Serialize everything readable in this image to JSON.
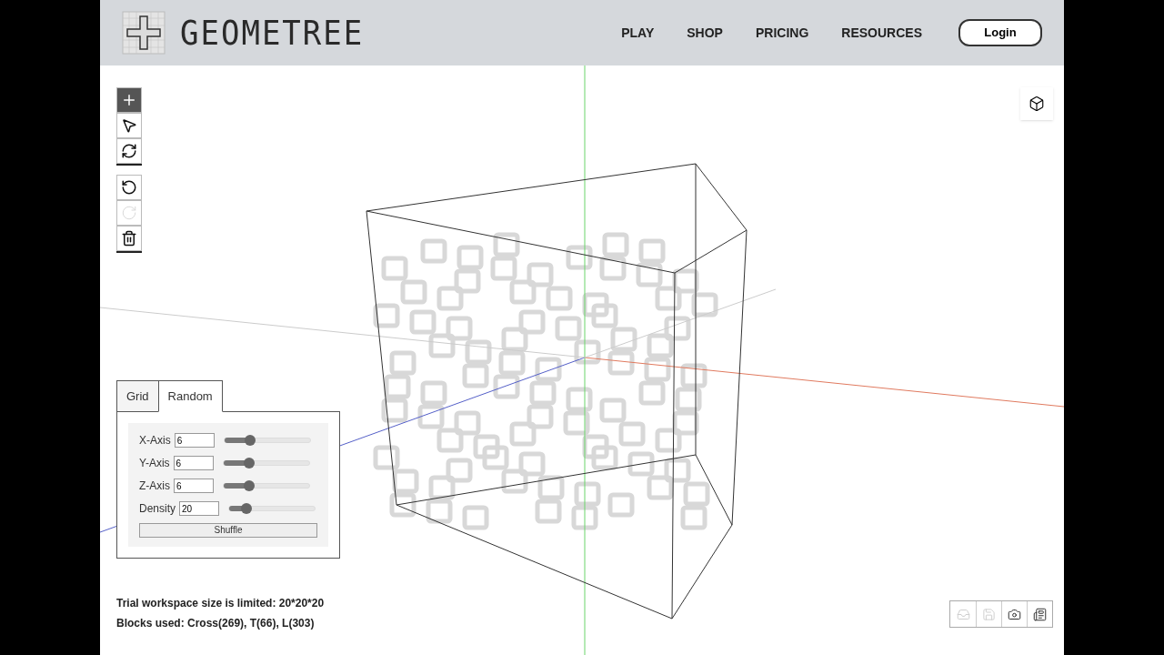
{
  "header": {
    "brand": "GEOMETREE",
    "nav": [
      {
        "label": "PLAY"
      },
      {
        "label": "SHOP"
      },
      {
        "label": "PRICING"
      },
      {
        "label": "RESOURCES"
      }
    ],
    "login": "Login"
  },
  "toolbar": [
    {
      "kind": "add",
      "selected": true,
      "disabled": false
    },
    {
      "kind": "select",
      "selected": false,
      "disabled": false
    },
    {
      "kind": "rotate",
      "selected": false,
      "disabled": false
    },
    {
      "kind": "undo",
      "selected": false,
      "disabled": false
    },
    {
      "kind": "redo",
      "selected": false,
      "disabled": true
    },
    {
      "kind": "delete",
      "selected": false,
      "disabled": false
    }
  ],
  "panel": {
    "tabs": [
      {
        "label": "Grid",
        "selected": false
      },
      {
        "label": "Random",
        "selected": true
      }
    ],
    "fields": [
      {
        "label": "X-Axis",
        "value": "6",
        "level": 0.3
      },
      {
        "label": "Y-Axis",
        "value": "6",
        "level": 0.3
      },
      {
        "label": "Z-Axis",
        "value": "6",
        "level": 0.3
      },
      {
        "label": "Density",
        "value": "20",
        "level": 0.2
      }
    ],
    "button": "Shuffle"
  },
  "info": [
    "Trial workspace size is limited: 20*20*20",
    "Blocks used: Cross(269), T(66), L(303)"
  ],
  "bottom_tools": [
    {
      "kind": "open",
      "disabled": true
    },
    {
      "kind": "save",
      "disabled": true
    },
    {
      "kind": "camera",
      "disabled": false
    },
    {
      "kind": "notes",
      "disabled": false
    }
  ]
}
